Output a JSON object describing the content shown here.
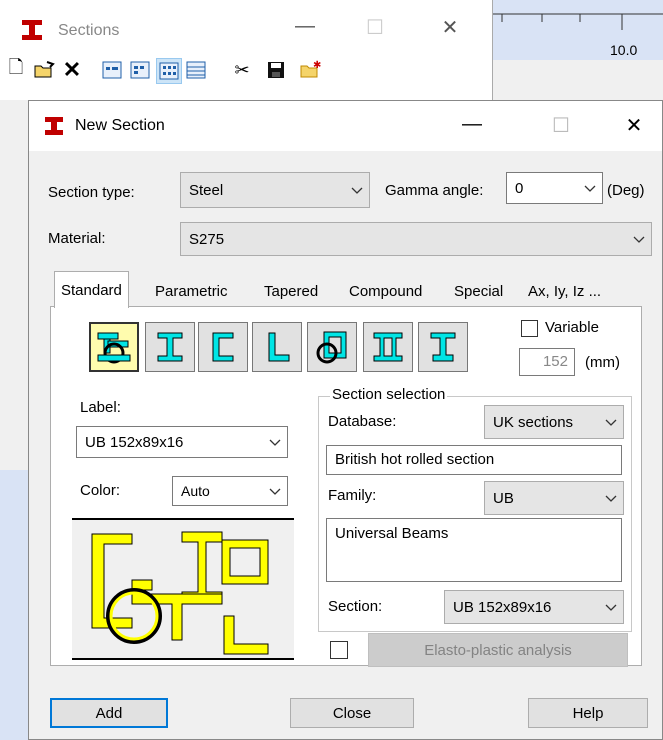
{
  "sections_window": {
    "title": "Sections",
    "ruler_value": "10.0"
  },
  "dialog": {
    "title": "New Section",
    "section_type_label": "Section type:",
    "section_type_value": "Steel",
    "gamma_label": "Gamma angle:",
    "gamma_value": "0",
    "gamma_unit": "(Deg)",
    "material_label": "Material:",
    "material_value": "S275",
    "tabs": [
      "Standard",
      "Parametric",
      "Tapered",
      "Compound",
      "Special",
      "Ax, Iy, Iz ..."
    ],
    "variable_label": "Variable",
    "variable_value": "152",
    "variable_unit": "(mm)",
    "label_label": "Label:",
    "label_value": "UB 152x89x16",
    "color_label": "Color:",
    "color_value": "Auto",
    "section_selection_label": "Section selection",
    "database_label": "Database:",
    "database_value": "UK sections",
    "database_desc": "British hot rolled section",
    "family_label": "Family:",
    "family_value": "UB",
    "family_desc": "Universal Beams",
    "section_label": "Section:",
    "section_value": "UB 152x89x16",
    "elasto_label": "Elasto-plastic analysis",
    "add_label": "Add",
    "close_label": "Close",
    "help_label": "Help"
  },
  "colors": {
    "accent": "#0078d7",
    "section_shape_fill": "#00e5e5",
    "preview_yellow": "#ffff00",
    "app_icon_red": "#c00000"
  }
}
